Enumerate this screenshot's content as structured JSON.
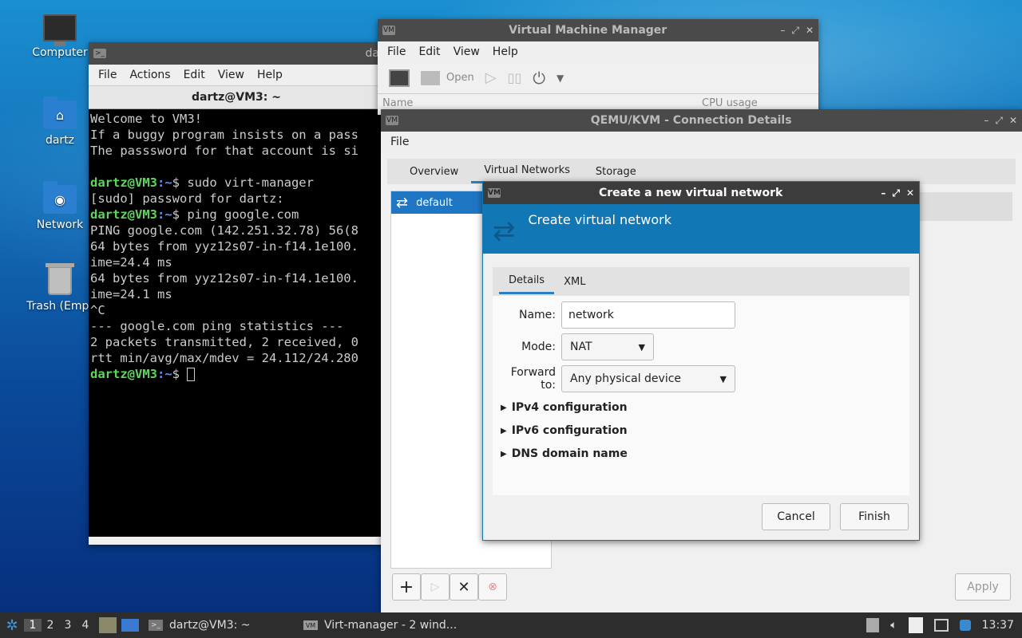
{
  "desktop": {
    "icons": [
      {
        "label": "Computer",
        "icon": "computer-icon"
      },
      {
        "label": "dartz",
        "icon": "home-folder-icon"
      },
      {
        "label": "Network",
        "icon": "network-folder-icon"
      },
      {
        "label": "Trash (Empt",
        "icon": "trash-icon"
      }
    ]
  },
  "terminal": {
    "window_title": "dartz@VM3: ~",
    "title_fragment": "da",
    "menu": [
      "File",
      "Actions",
      "Edit",
      "View",
      "Help"
    ],
    "tab_title": "dartz@VM3: ~",
    "lines": [
      {
        "type": "text",
        "text": "Welcome to VM3!"
      },
      {
        "type": "text",
        "text": "If a buggy program insists on a pass"
      },
      {
        "type": "text",
        "text": "The passsword for that account is si"
      },
      {
        "type": "text",
        "text": ""
      },
      {
        "type": "prompt",
        "user": "dartz@VM3",
        "path": ":~",
        "cmd": "$ sudo virt-manager"
      },
      {
        "type": "text",
        "text": "[sudo] password for dartz:"
      },
      {
        "type": "prompt",
        "user": "dartz@VM3",
        "path": ":~",
        "cmd": "$ ping google.com"
      },
      {
        "type": "text",
        "text": "PING google.com (142.251.32.78) 56(8"
      },
      {
        "type": "text",
        "text": "64 bytes from yyz12s07-in-f14.1e100."
      },
      {
        "type": "text",
        "text": "ime=24.4 ms"
      },
      {
        "type": "text",
        "text": "64 bytes from yyz12s07-in-f14.1e100."
      },
      {
        "type": "text",
        "text": "ime=24.1 ms"
      },
      {
        "type": "text",
        "text": "^C"
      },
      {
        "type": "text",
        "text": "--- google.com ping statistics ---"
      },
      {
        "type": "text",
        "text": "2 packets transmitted, 2 received, 0"
      },
      {
        "type": "text",
        "text": "rtt min/avg/max/mdev = 24.112/24.280"
      },
      {
        "type": "prompt",
        "user": "dartz@VM3",
        "path": ":~",
        "cmd": "$ "
      }
    ]
  },
  "vmm": {
    "title": "Virtual Machine Manager",
    "menu": [
      "File",
      "Edit",
      "View",
      "Help"
    ],
    "toolbar": {
      "open_label": "Open"
    },
    "columns": {
      "name": "Name",
      "cpu": "CPU usage"
    }
  },
  "conn": {
    "title": "QEMU/KVM - Connection Details",
    "menu": [
      "File"
    ],
    "tabs": [
      "Overview",
      "Virtual Networks",
      "Storage"
    ],
    "selected_tab": "Virtual Networks",
    "networks": [
      {
        "name": "default",
        "icon": "network-arrows-icon"
      }
    ],
    "apply_label": "Apply"
  },
  "dialog": {
    "title": "Create a new virtual network",
    "banner": "Create virtual network",
    "tabs": [
      "Details",
      "XML"
    ],
    "name_label": "Name:",
    "name_value": "network",
    "mode_label": "Mode:",
    "mode_value": "NAT",
    "forward_label": "Forward to:",
    "forward_value": "Any physical device",
    "expanders": [
      "IPv4 configuration",
      "IPv6 configuration",
      "DNS domain name"
    ],
    "cancel_label": "Cancel",
    "finish_label": "Finish"
  },
  "taskbar": {
    "workspaces": [
      "1",
      "2",
      "3",
      "4"
    ],
    "selected_workspace": "1",
    "tasks": [
      {
        "label": "dartz@VM3: ~",
        "icon": "terminal-icon"
      },
      {
        "label": "Virt-manager - 2 wind...",
        "icon": "virt-manager-icon"
      }
    ],
    "clock": "13:37"
  },
  "colors": {
    "accent": "#1177b5",
    "prompt_green": "#5fd75f",
    "prompt_blue": "#5f8fff"
  }
}
